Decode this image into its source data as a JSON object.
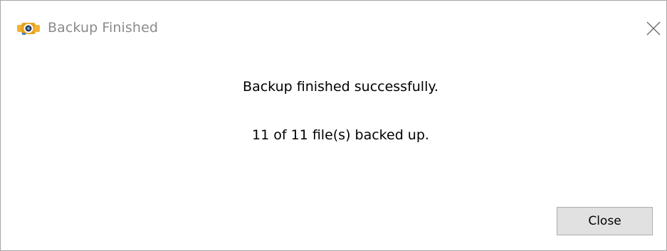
{
  "window": {
    "title": "Backup Finished",
    "app_icon": "camera-app-icon",
    "close_icon": "close-icon"
  },
  "message": {
    "line1": "Backup finished successfully.",
    "line2": "11 of 11 file(s) backed up."
  },
  "buttons": {
    "close_label": "Close"
  },
  "colors": {
    "title_text": "#8a8a8a",
    "button_bg": "#e1e1e1",
    "button_border": "#adadad",
    "window_border": "#a6a6a6"
  }
}
